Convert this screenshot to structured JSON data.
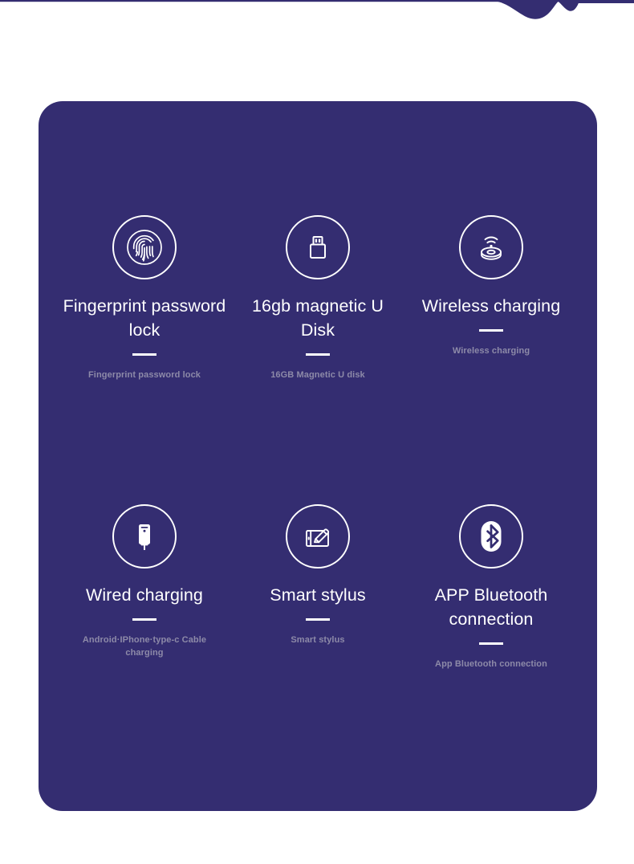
{
  "theme": {
    "page_background": "#ffffff",
    "card_background": "#342D71",
    "accent": "#342D71",
    "title_color": "#ffffff",
    "subtitle_color": "#8D8AA8",
    "divider_color": "#ffffff"
  },
  "decoration": {
    "name": "top-wave-decoration",
    "color": "#342D71"
  },
  "card": {
    "features": [
      {
        "icon": "fingerprint-icon",
        "title": "Fingerprint password lock",
        "subtitle": "Fingerprint password lock"
      },
      {
        "icon": "usb-flash-drive-icon",
        "title": "16gb magnetic U Disk",
        "subtitle": "16GB Magnetic U disk"
      },
      {
        "icon": "wireless-charging-pad-icon",
        "title": "Wireless charging",
        "subtitle": "Wireless charging"
      },
      {
        "icon": "power-bank-plug-icon",
        "title": "Wired charging",
        "subtitle": "Android·IPhone·type-c Cable charging"
      },
      {
        "icon": "stylus-tablet-icon",
        "title": "Smart stylus",
        "subtitle": "Smart stylus"
      },
      {
        "icon": "bluetooth-icon",
        "title": "APP Bluetooth connection",
        "subtitle": "App Bluetooth connection"
      }
    ]
  }
}
